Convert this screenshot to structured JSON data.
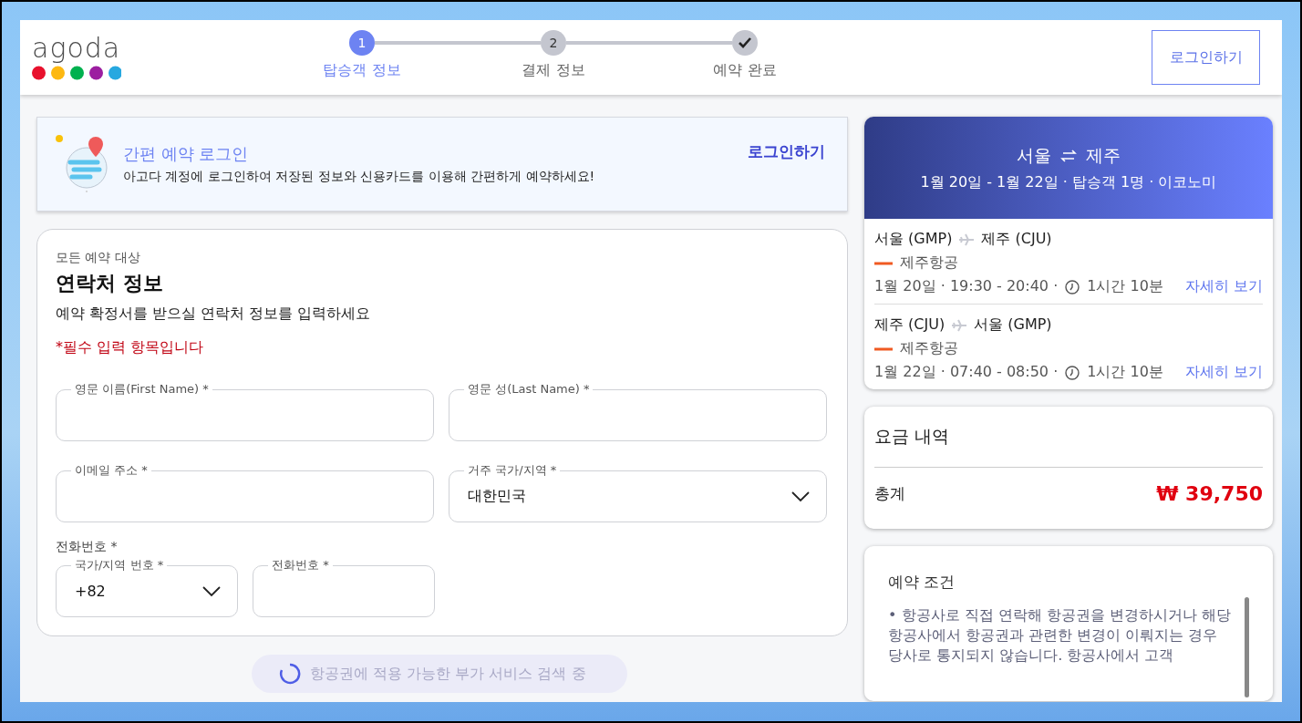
{
  "header": {
    "logo": "agoda",
    "steps": [
      {
        "number": "1",
        "label": "탑승객 정보",
        "kind": "number",
        "selected": true
      },
      {
        "number": "2",
        "label": "결제 정보",
        "kind": "number",
        "selected": false
      },
      {
        "label": "예약 완료",
        "kind": "check",
        "selected": false
      }
    ],
    "login_button": "로그인하기"
  },
  "login_banner": {
    "title": "간편 예약 로그인",
    "description": "아고다 계정에 로그인하여 저장된 정보와 신용카드를 이용해 간편하게 예약하세요!",
    "link": "로그인하기"
  },
  "contact": {
    "eyebrow": "모든 예약 대상",
    "title": "연락처 정보",
    "description": "예약 확정서를 받으실 연락처 정보를 입력하세요",
    "required_note": "*필수 입력 항목입니다",
    "fields": [
      {
        "label": "영문 이름(First Name) *",
        "kind": "text"
      },
      {
        "label": "영문 성(Last Name) *",
        "kind": "text"
      },
      {
        "label": "이메일 주소 *",
        "kind": "text"
      },
      {
        "label": "거주 국가/지역 *",
        "kind": "select",
        "value": "대한민국"
      }
    ],
    "phone": {
      "label": "전화번호 *",
      "fields": [
        {
          "label": "국가/지역 번호 *",
          "kind": "select",
          "value": "+82"
        },
        {
          "label": "전화번호 *",
          "kind": "text"
        }
      ]
    }
  },
  "loading": {
    "text": "항공권에 적용 가능한 부가 서비스 검색 중"
  },
  "trip": {
    "route_from": "서울",
    "route_to": "제주",
    "summary": "1월 20일 - 1월 22일 · 탑승객 1명 · 이코노미",
    "segments": [
      {
        "from": "서울 (GMP)",
        "to": "제주 (CJU)",
        "airline": "제주항공",
        "schedule": "1월 20일 · 19:30 - 20:40 ·",
        "duration": "1시간 10분",
        "link": "자세히 보기"
      },
      {
        "from": "제주 (CJU)",
        "to": "서울 (GMP)",
        "airline": "제주항공",
        "schedule": "1월 22일 · 07:40 - 08:50 ·",
        "duration": "1시간 10분",
        "link": "자세히 보기"
      }
    ]
  },
  "fare": {
    "title": "요금 내역",
    "total_label": "총계",
    "total": "₩ 39,750"
  },
  "terms": {
    "title": "예약 조건",
    "text": "• 항공사로 직접 연락해 항공권을 변경하시거나 해당 항공사에서 항공권과 관련한 변경이 이뤄지는 경우 당사로 통지되지 않습니다. 항공사에서 고객"
  }
}
